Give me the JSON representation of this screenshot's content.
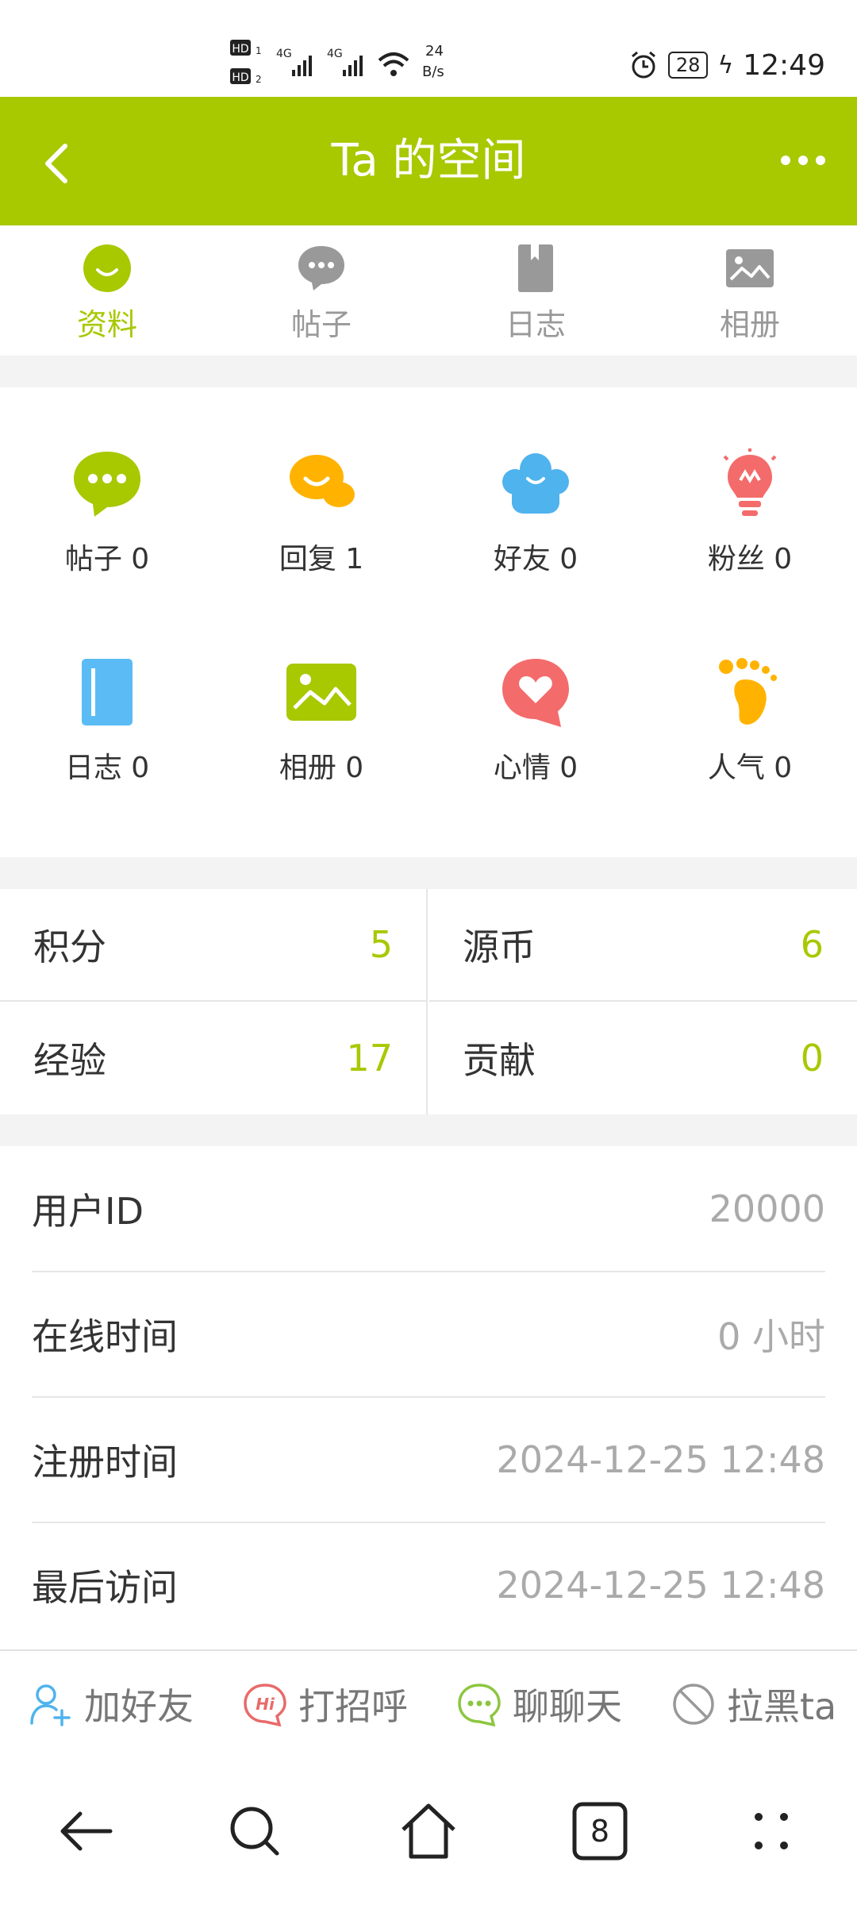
{
  "status_bar": {
    "hd1": "HD",
    "hd1_sub": "1",
    "hd2": "HD",
    "hd2_sub": "2",
    "net1": "4G",
    "net2": "4G",
    "speed_value": "24",
    "speed_unit": "B/s",
    "battery": "28",
    "time": "12:49"
  },
  "header": {
    "title": "Ta 的空间"
  },
  "tabs": [
    {
      "label": "资料",
      "icon": "smile-icon",
      "active": true
    },
    {
      "label": "帖子",
      "icon": "chat-bubble-icon",
      "active": false
    },
    {
      "label": "日志",
      "icon": "bookmark-icon",
      "active": false
    },
    {
      "label": "相册",
      "icon": "picture-icon",
      "active": false
    }
  ],
  "stats": [
    {
      "label": "帖子 0",
      "icon": "chat-bubble-icon",
      "color": "#a8c800"
    },
    {
      "label": "回复 1",
      "icon": "reply-bubbles-icon",
      "color": "#ffb300"
    },
    {
      "label": "好友 0",
      "icon": "friends-icon",
      "color": "#4fb3ee"
    },
    {
      "label": "粉丝 0",
      "icon": "lightbulb-icon",
      "color": "#f46b6b"
    },
    {
      "label": "日志 0",
      "icon": "notebook-icon",
      "color": "#5bbcf5"
    },
    {
      "label": "相册 0",
      "icon": "picture-icon",
      "color": "#a8c800"
    },
    {
      "label": "心情 0",
      "icon": "heart-bubble-icon",
      "color": "#f46b6b"
    },
    {
      "label": "人气 0",
      "icon": "footprint-icon",
      "color": "#ffb300"
    }
  ],
  "points": [
    {
      "label": "积分",
      "value": "5"
    },
    {
      "label": "源币",
      "value": "6"
    },
    {
      "label": "经验",
      "value": "17"
    },
    {
      "label": "贡献",
      "value": "0"
    }
  ],
  "info": [
    {
      "label": "用户ID",
      "value": "20000"
    },
    {
      "label": "在线时间",
      "value": "0 小时"
    },
    {
      "label": "注册时间",
      "value": "2024-12-25 12:48"
    },
    {
      "label": "最后访问",
      "value": "2024-12-25 12:48"
    }
  ],
  "actions": [
    {
      "label": "加好友",
      "icon": "add-user-icon",
      "color": "#4fb3ee"
    },
    {
      "label": "打招呼",
      "icon": "hi-icon",
      "color": "#e86a6a"
    },
    {
      "label": "聊聊天",
      "icon": "chat-icon",
      "color": "#8cc63f"
    },
    {
      "label": "拉黑ta",
      "icon": "block-icon",
      "color": "#999999"
    }
  ],
  "system_nav": {
    "tab_count": "8"
  },
  "colors": {
    "accent": "#a8c800",
    "background_gap": "#f3f3f3"
  }
}
